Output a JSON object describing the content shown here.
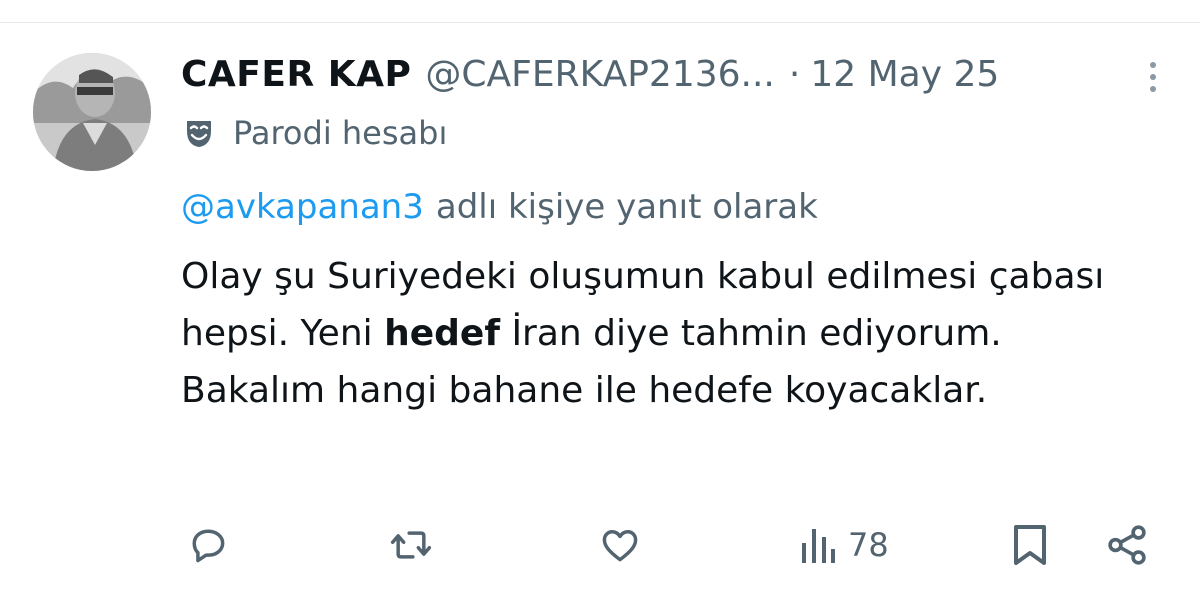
{
  "tweet": {
    "author": {
      "display_name": "CAFER KAP",
      "handle": "@CAFERKAP2136...",
      "separator": "·",
      "date": "12 May 25",
      "account_label": "Parodi hesabı",
      "account_label_icon": "theater-mask-icon",
      "avatar": "avatar-photo"
    },
    "reply_context": {
      "mention": "@avkapanan3",
      "suffix": "adlı kişiye yanıt olarak"
    },
    "text": {
      "before_bold": "Olay şu Suriyedeki oluşumun kabul edilmesi çabası hepsi. Yeni ",
      "bold": "hedef",
      "after_bold": " İran diye tahmin ediyorum. Bakalım hangi bahane ile hedefe koyacaklar."
    },
    "actions": {
      "reply_icon": "reply-icon",
      "retweet_icon": "retweet-icon",
      "like_icon": "heart-icon",
      "views_icon": "views-icon",
      "views_count": "78",
      "bookmark_icon": "bookmark-icon",
      "share_icon": "share-icon"
    },
    "more_icon": "more-vertical-icon"
  },
  "colors": {
    "primary_text": "#0f1419",
    "secondary_text": "#536471",
    "accent": "#1d9bf0",
    "divider": "#e6e9eb"
  }
}
